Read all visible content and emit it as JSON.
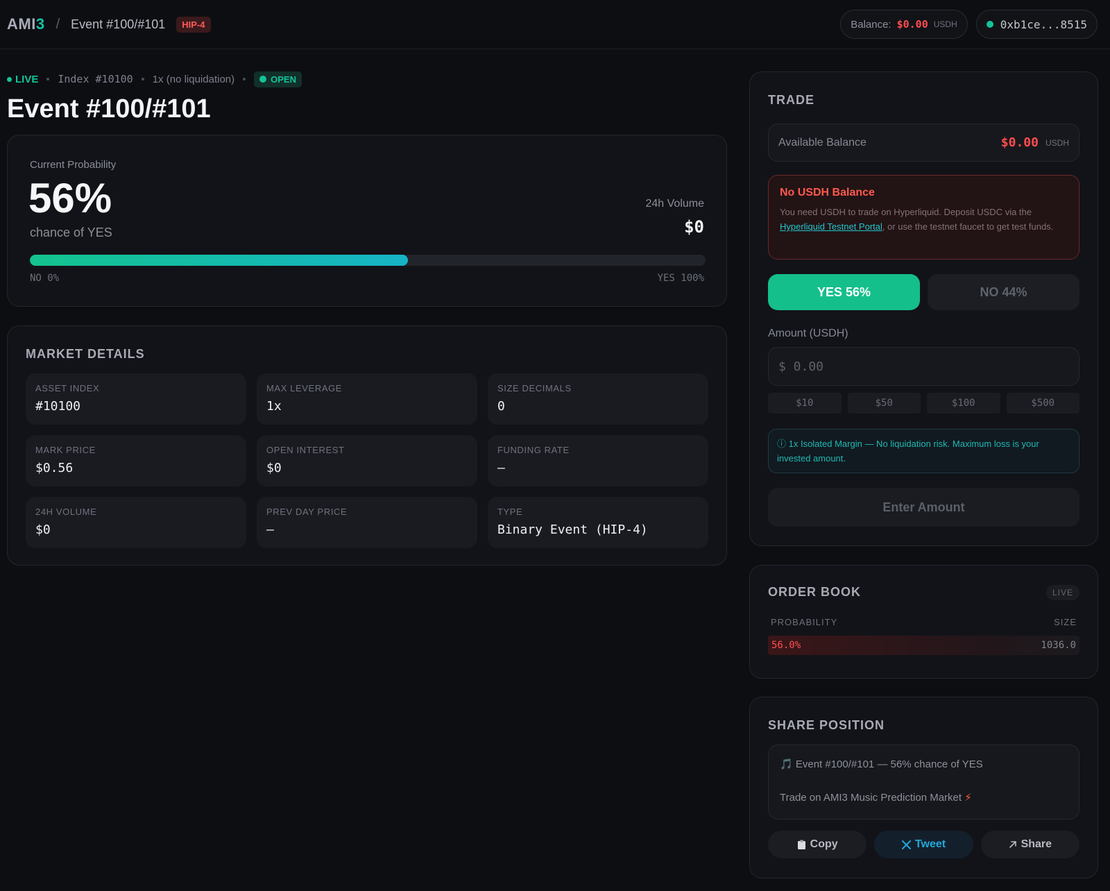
{
  "header": {
    "logo_main": "AMI",
    "logo_accent": "3",
    "separator": "/",
    "breadcrumb": "Event #100/#101",
    "badge": "HIP-4",
    "balance_label": "Balance:",
    "balance_value": "$0.00",
    "balance_unit": "USDH",
    "wallet": "0xb1ce...8515"
  },
  "status": {
    "live": "LIVE",
    "index": "Index #10100",
    "leverage": "1x (no liquidation)",
    "state": "OPEN"
  },
  "event_title": "Event #100/#101",
  "probability": {
    "label": "Current Probability",
    "value": "56%",
    "fraction": 0.56,
    "sub": "chance of YES",
    "volume_label": "24h Volume",
    "volume_value": "$0",
    "left_end": "NO 0%",
    "right_end": "YES 100%"
  },
  "market_details": {
    "title": "MARKET DETAILS",
    "items": [
      {
        "key": "ASSET INDEX",
        "value": "#10100"
      },
      {
        "key": "MAX LEVERAGE",
        "value": "1x"
      },
      {
        "key": "SIZE DECIMALS",
        "value": "0"
      },
      {
        "key": "MARK PRICE",
        "value": "$0.56"
      },
      {
        "key": "OPEN INTEREST",
        "value": "$0"
      },
      {
        "key": "FUNDING RATE",
        "value": "—"
      },
      {
        "key": "24H VOLUME",
        "value": "$0"
      },
      {
        "key": "PREV DAY PRICE",
        "value": "—"
      },
      {
        "key": "TYPE",
        "value": "Binary Event (HIP-4)"
      }
    ]
  },
  "trade": {
    "title": "TRADE",
    "available_label": "Available Balance",
    "available_value": "$0.00",
    "available_unit": "USDH",
    "warning_title": "No USDH Balance",
    "warning_text_1": "You need USDH to trade on Hyperliquid. Deposit USDC via the ",
    "warning_link": "Hyperliquid Testnet Portal",
    "warning_text_2": ", or use the testnet faucet to get test funds.",
    "yes_label": "YES 56%",
    "no_label": "NO 44%",
    "amount_label": "Amount (USDH)",
    "amount_placeholder": "$ 0.00",
    "quick_amounts": [
      "$10",
      "$50",
      "$100",
      "$500"
    ],
    "info_text": "ⓘ 1x Isolated Margin — No liquidation risk. Maximum loss is your invested amount.",
    "submit_label": "Enter Amount"
  },
  "order_book": {
    "title": "ORDER BOOK",
    "live_chip": "LIVE",
    "col_probability": "PROBABILITY",
    "col_size": "SIZE",
    "rows": [
      {
        "probability": "56.0%",
        "size": "1036.0"
      }
    ]
  },
  "share": {
    "title": "SHARE POSITION",
    "line1": "🎵 Event #100/#101 — 56% chance of YES",
    "line2": "Trade on AMI3 Music Prediction Market ",
    "line2_emoji": "⚡",
    "copy_label": "Copy",
    "tweet_label": "Tweet",
    "share_label": "Share"
  },
  "colors": {
    "accent": "#14c3a8",
    "yes": "#14bf8b",
    "danger": "#ff4d4d",
    "background": "#0d0e12"
  }
}
